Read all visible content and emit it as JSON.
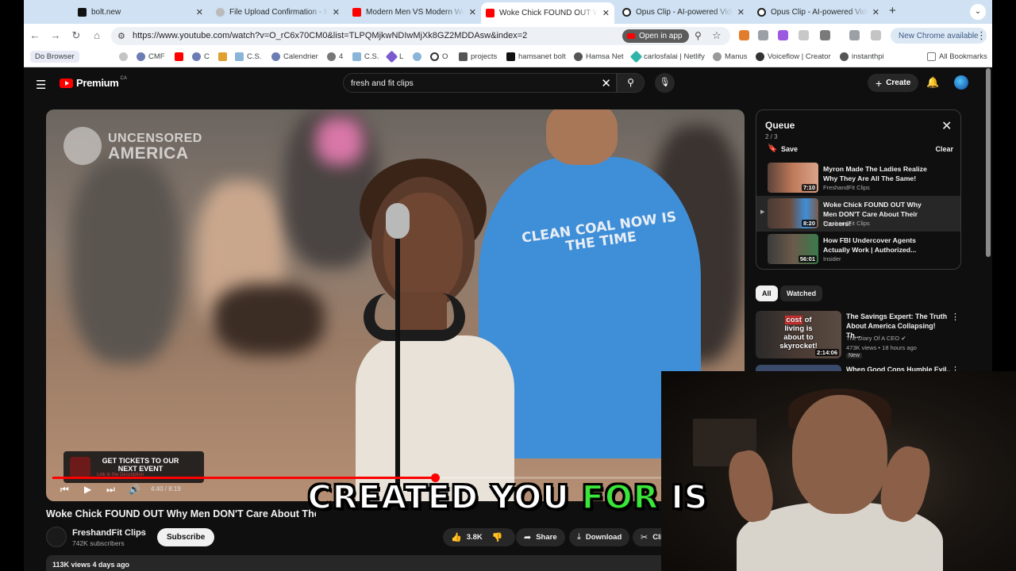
{
  "browser": {
    "tabs": [
      {
        "title": "bolt.new",
        "color": "#111111"
      },
      {
        "title": "File Upload Confirmation - Ma",
        "color": "#888888"
      },
      {
        "title": "Modern Men VS Modern Wom",
        "color": "#ff0000"
      },
      {
        "title": "Woke Chick FOUND OUT Wh",
        "color": "#ff0000"
      },
      {
        "title": "Opus Clip - AI-powered Video",
        "color": "#222222"
      },
      {
        "title": "Opus Clip - AI-powered Video",
        "color": "#222222"
      }
    ],
    "url": "https://www.youtube.com/watch?v=O_rC6x70CM0&list=TLPQMjkwNDIwMjXk8GZ2MDDAsw&index=2",
    "open_in_app": "Open in app",
    "new_chrome": "New Chrome available",
    "bookmarks": [
      "Do Browser",
      "CMF",
      "C",
      "C.S.",
      "Calendrier",
      "4",
      "C.S.",
      "L",
      "O",
      "projects",
      "hamsanet bolt",
      "Hamsa Net",
      "carlosfalai | Netlify",
      "Manus",
      "Voiceflow | Creator",
      "instanthpi",
      "All Bookmarks"
    ]
  },
  "youtube": {
    "logo": "Premium",
    "logo_region": "CA",
    "search_value": "fresh and fit clips",
    "create_label": "Create",
    "video": {
      "watermark_line1": "UNCENSORED",
      "watermark_line2": "AMERICA",
      "shirt_text": "CLEAN COAL NOW IS THE TIME",
      "tickets_text": "GET TICKETS TO OUR NEXT EVENT",
      "tickets_sub": "Link in the Description",
      "time": "4:40 / 8:19",
      "progress": 0.558,
      "title": "Woke Chick FOUND OUT Why Men DON'T Care About Their Careers!",
      "channel": "FreshandFit Clips",
      "subscribers": "742K subscribers",
      "subscribe_label": "Subscribe",
      "likes": "3.8K",
      "share_label": "Share",
      "download_label": "Download",
      "clip_label": "Clip",
      "views": "113K views  4 days ago"
    },
    "queue": {
      "title": "Queue",
      "count": "2 / 3",
      "save_label": "Save",
      "clear_label": "Clear",
      "items": [
        {
          "title": "Myron Made The Ladies Realize Why They Are All The Same!",
          "channel": "FreshandFit Clips",
          "duration": "7:10"
        },
        {
          "title": "Woke Chick FOUND OUT Why Men DON'T Care About Their Careers!",
          "channel": "FreshandFit Clips",
          "duration": "8:20"
        },
        {
          "title": "How FBI Undercover Agents Actually Work | Authorized...",
          "channel": "Insider",
          "duration": "56:01"
        }
      ]
    },
    "chips": [
      "All",
      "Watched"
    ],
    "recommendations": [
      {
        "title": "The Savings Expert: The Truth About America Collapsing! Th...",
        "channel": "The Diary Of A CEO",
        "meta": "473K views  •  18 hours ago",
        "badge": "New",
        "duration": "2:14:06",
        "thumb_text_red": "cost",
        "thumb_text": "of living is about to skyrocket!"
      },
      {
        "title": "When Good Cops Humble Evil..."
      }
    ]
  },
  "caption": {
    "before": "CREATED YOU ",
    "highlight": "FOR",
    "after": " IS"
  }
}
